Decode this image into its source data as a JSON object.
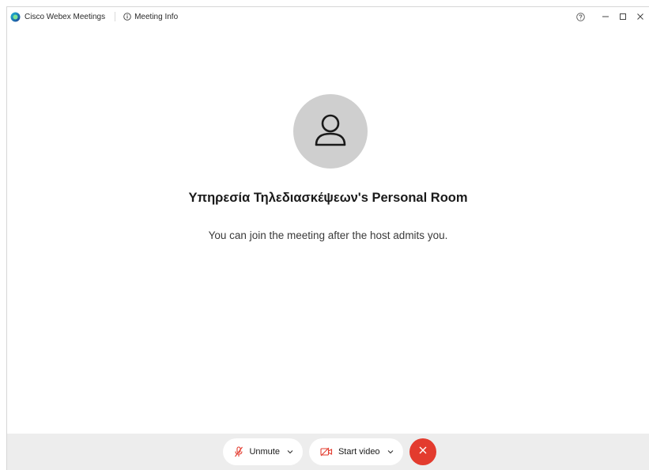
{
  "titlebar": {
    "app_name": "Cisco Webex Meetings",
    "app_icon": "webex-logo-icon",
    "meeting_info_label": "Meeting Info",
    "controls": [
      "help-icon",
      "minimize-icon",
      "maximize-icon",
      "close-icon"
    ]
  },
  "main": {
    "avatar_icon": "person-icon",
    "room_title": "Υπηρεσία Τηλεδιασκέψεων's Personal Room",
    "message": "You can join the meeting after the host admits you."
  },
  "toolbar": {
    "unmute_label": "Unmute",
    "start_video_label": "Start video",
    "end_icon": "close-icon"
  },
  "colors": {
    "accent_red": "#e33b2e",
    "avatar_bg": "#cfcfcf",
    "toolbar_bg": "#ededed"
  }
}
